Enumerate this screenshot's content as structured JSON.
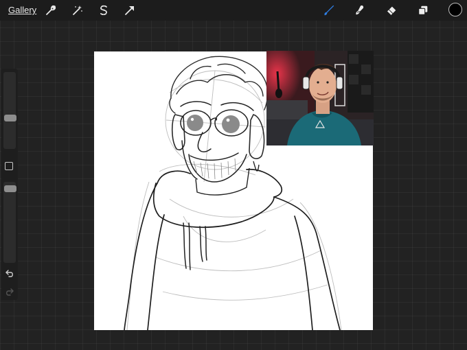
{
  "topbar": {
    "gallery_label": "Gallery",
    "tools": [
      {
        "icon": "wrench-icon",
        "name": "actions"
      },
      {
        "icon": "magic-wand-icon",
        "name": "adjustments"
      },
      {
        "icon": "selection-s-icon",
        "name": "selection"
      },
      {
        "icon": "transform-arrow-icon",
        "name": "transform"
      },
      {
        "icon": "brush-icon",
        "name": "paint",
        "active": true
      },
      {
        "icon": "smudge-icon",
        "name": "smudge"
      },
      {
        "icon": "eraser-icon",
        "name": "eraser"
      },
      {
        "icon": "layers-icon",
        "name": "layers"
      }
    ],
    "active_color": "#000000",
    "accent": "#2f7de1"
  },
  "sidebar": {
    "brush_size_level": 0.55,
    "opacity_level": 0.93,
    "icons": [
      "square-modify-icon",
      "undo-icon",
      "redo-icon"
    ]
  },
  "canvas": {
    "background": "#ffffff"
  },
  "webcam": {
    "hoodie_color": "#1b6a77",
    "wall_light_color": "#d02a3a"
  }
}
